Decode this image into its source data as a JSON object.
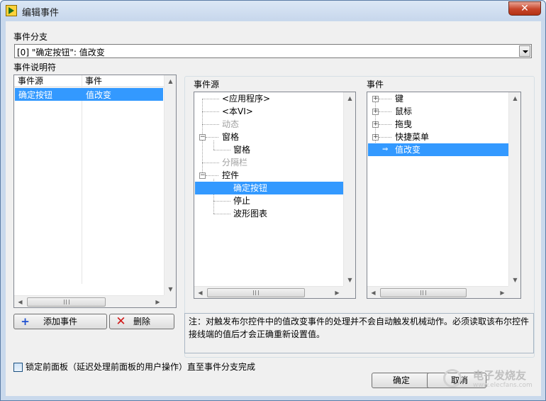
{
  "window": {
    "title": "编辑事件",
    "close_symbol": "✕"
  },
  "event_case": {
    "label": "事件分支",
    "selected": "[0] \"确定按钮\": 值改变"
  },
  "specifiers": {
    "label": "事件说明符",
    "columns": [
      "事件源",
      "事件"
    ],
    "rows": [
      {
        "source": "确定按钮",
        "event": "值改变"
      }
    ]
  },
  "event_sources": {
    "label": "事件源",
    "items": [
      "<应用程序>",
      "<本VI>",
      "动态",
      "窗格",
      "窗格",
      "分隔栏",
      "控件",
      "确定按钮",
      "停止",
      "波形图表"
    ]
  },
  "events": {
    "label": "事件",
    "items": [
      "键",
      "鼠标",
      "拖曳",
      "快捷菜单",
      "值改变"
    ]
  },
  "buttons": {
    "add_event": "添加事件",
    "delete": "删除",
    "ok": "确定",
    "cancel": "取消"
  },
  "note": "注：对触发布尔控件中的值改变事件的处理并不会自动触发机械动作。必须读取该布尔控件接线端的值后才会正确重新设置值。",
  "lock_panel": {
    "label": "锁定前面板（延迟处理前面板的用户操作）直至事件分支完成",
    "checked": false
  },
  "watermark": "电子发烧友",
  "watermark_url": "www.elecfans.com"
}
